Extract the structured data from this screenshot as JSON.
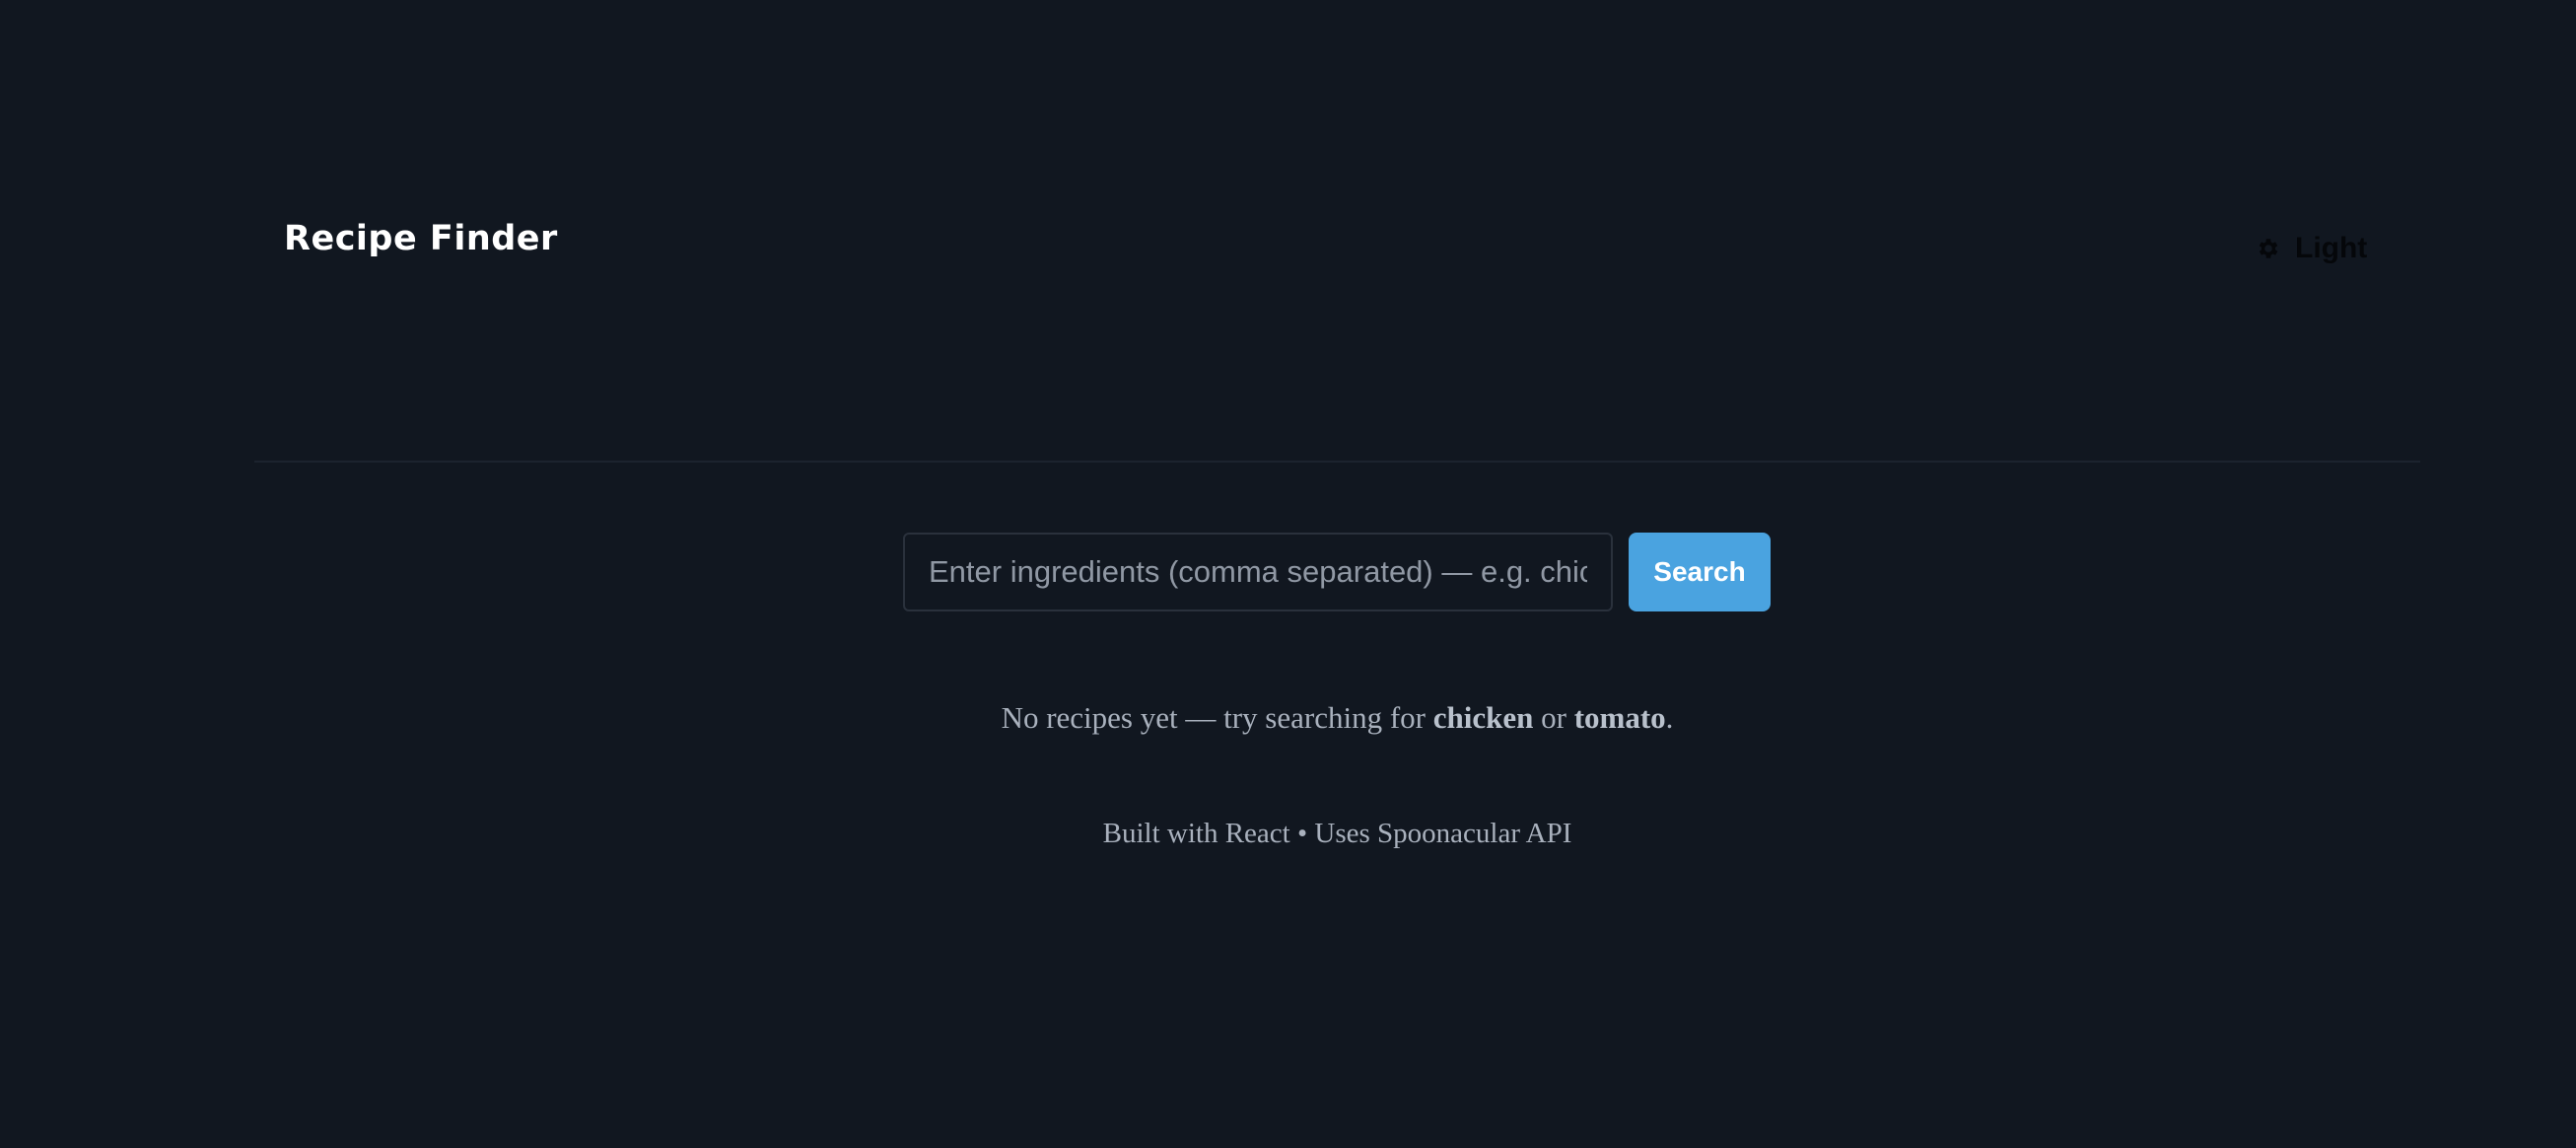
{
  "header": {
    "title": "Recipe Finder",
    "theme_toggle": {
      "icon": "gear-icon",
      "label": "Light"
    }
  },
  "search": {
    "value": "",
    "placeholder": "Enter ingredients (comma separated) — e.g. chicken, tomato",
    "button_label": "Search"
  },
  "empty_state": {
    "prefix": "No recipes yet — try searching for ",
    "term1": "chicken",
    "connector": " or ",
    "term2": "tomato",
    "suffix": "."
  },
  "footer": {
    "text": "Built with React • Uses Spoonacular API"
  },
  "colors": {
    "background": "#111720",
    "accent": "#4aa3e0",
    "muted_text": "#a9b1bd"
  }
}
